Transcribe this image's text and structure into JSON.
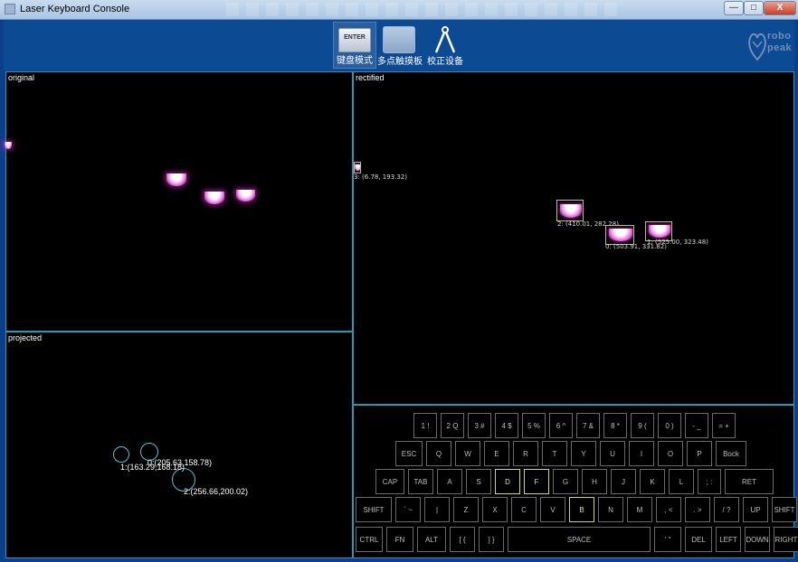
{
  "window": {
    "title": "Laser Keyboard Console",
    "minimize": "—",
    "maximize": "□",
    "close": "X"
  },
  "toolbar": {
    "tools": [
      {
        "label": "键盘模式",
        "icon_text": "ENTER",
        "icon": "enter-key-icon",
        "active": true
      },
      {
        "label": "多点触摸板",
        "icon": "touchpad-icon",
        "active": false
      },
      {
        "label": "校正设备",
        "icon": "compass-icon",
        "active": false
      }
    ],
    "logo_text": [
      "robo",
      "peak"
    ]
  },
  "panels": {
    "original": {
      "label": "original"
    },
    "rectified": {
      "label": "rectified",
      "points": [
        {
          "text": "3: (6.78, 193.32)"
        },
        {
          "text": "2: (410.01, 282.28)"
        },
        {
          "text": "0: (503.91, 331.82)"
        },
        {
          "text": "1: (525.00, 323.48)"
        }
      ]
    },
    "projected": {
      "label": "projected",
      "points": [
        {
          "text": "1:(163.29,168.18)"
        },
        {
          "text": "0:(205.63,158.78)"
        },
        {
          "text": "2:(256.66,200.02)"
        }
      ]
    }
  },
  "keyboard": {
    "highlight_color": "#e6e640",
    "rows": [
      [
        "1 !",
        "2 Q",
        "3 #",
        "4 $",
        "5 %",
        "6 ^",
        "7 &",
        "8 *",
        "9 (",
        "0 )",
        "- _",
        "= +"
      ],
      [
        "ESC",
        "Q",
        "W",
        "E",
        "R",
        "T",
        "Y",
        "U",
        "I",
        "O",
        "P",
        "Bock"
      ],
      [
        "CAP",
        "TAB",
        "A",
        "S",
        "D",
        "F",
        "G",
        "H",
        "J",
        "K",
        "L",
        "; :",
        "RET"
      ],
      [
        "SHIFT",
        "` ~",
        "|",
        "Z",
        "X",
        "C",
        "V",
        "B",
        "N",
        "M",
        ", <",
        ". >",
        "/ ?",
        "UP",
        "SHIFT"
      ],
      [
        "CTRL",
        "FN",
        "ALT",
        "[ {",
        "] }",
        "SPACE",
        "' \"",
        "DEL",
        "LEFT",
        "DOWN",
        "RIGHT"
      ]
    ],
    "highlighted": [
      "D",
      "F",
      "B"
    ]
  }
}
